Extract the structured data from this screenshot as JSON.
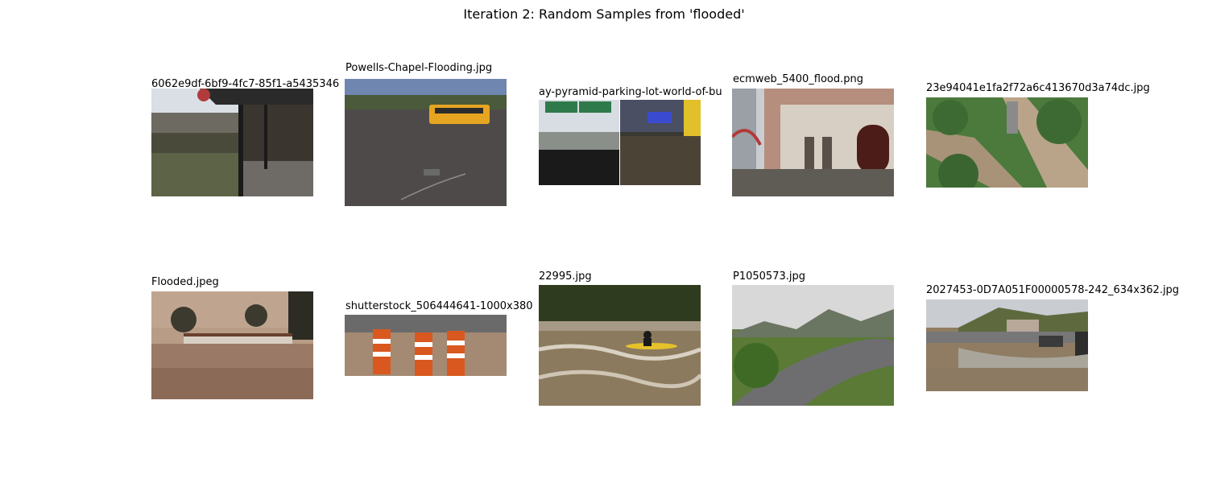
{
  "figure": {
    "title": "Iteration 2: Random Samples from 'flooded'"
  },
  "samples": [
    {
      "label": "6062e9df-6bf9-4fc7-85f1-a5435346",
      "scene": "flooded-street-with-covered-walkway"
    },
    {
      "label": "Powells-Chapel-Flooding.jpg",
      "scene": "school-bus-in-flood-water"
    },
    {
      "label": "ay-pyramid-parking-lot-world-of-bu",
      "scene": "flooded-parking-lot-split-view"
    },
    {
      "label": "ecmweb_5400_flood.png",
      "scene": "flooded-building-entrance"
    },
    {
      "label": "23e94041e1fa2f72a6c413670d3a74dc.jpg",
      "scene": "aerial-flooded-highway"
    },
    {
      "label": "Flooded.jpeg",
      "scene": "submerged-roadside-building"
    },
    {
      "label": "shutterstock_506444641-1000x380",
      "scene": "traffic-barrels-in-flood-water"
    },
    {
      "label": "22995.jpg",
      "scene": "kayaker-in-rapids"
    },
    {
      "label": "P1050573.jpg",
      "scene": "river-valley-with-mountains"
    },
    {
      "label": "2027453-0D7A051F00000578-242_634x362.jpg",
      "scene": "waves-over-seawall"
    }
  ]
}
